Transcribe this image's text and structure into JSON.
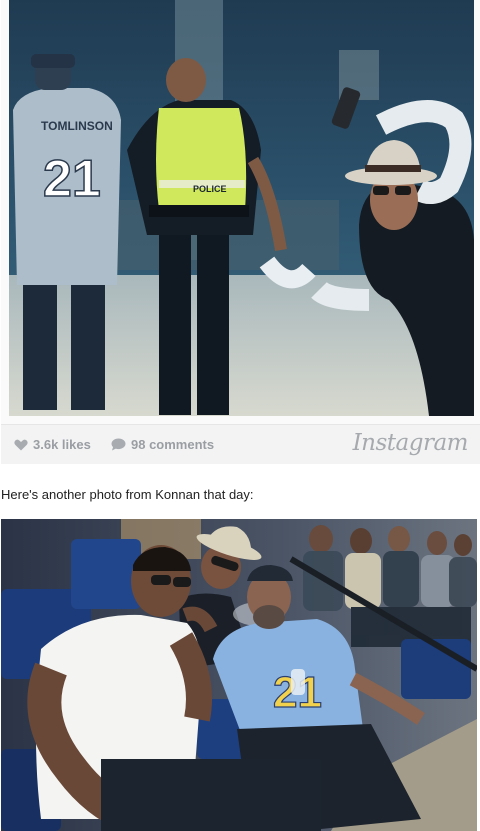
{
  "instagram_embed": {
    "photo1": {
      "jersey_name": "TOMLINSON",
      "jersey_number": "21",
      "vest_text": "POLICE"
    },
    "likes": "3.6k likes",
    "comments": "98 comments",
    "brand": "Instagram"
  },
  "article": {
    "caption_text": "Here's another photo from Konnan that day:"
  },
  "photo2": {
    "jersey_number": "21"
  }
}
